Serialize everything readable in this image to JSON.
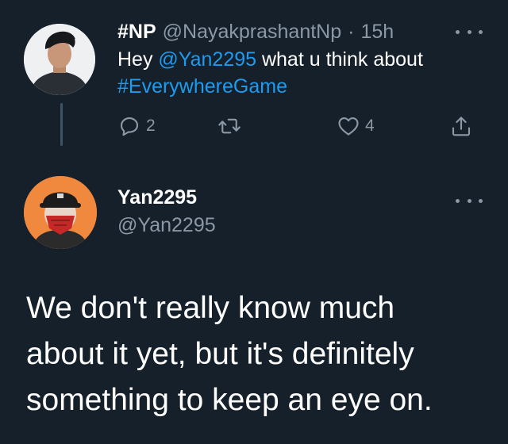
{
  "parent_tweet": {
    "display_name": "#NP",
    "handle": "@NayakprashantNp",
    "separator": "·",
    "time": "15h",
    "text_before": "Hey ",
    "mention": "@Yan2295",
    "text_after": " what u think about",
    "hashtag": "#EverywhereGame",
    "reply_count": "2",
    "like_count": "4",
    "icons": {
      "reply": "reply-icon",
      "retweet": "retweet-icon",
      "like": "heart-icon",
      "share": "share-icon",
      "more": "more-icon"
    }
  },
  "reply_tweet": {
    "display_name": "Yan2295",
    "handle": "@Yan2295",
    "text_line1": "We don't really know much",
    "text_line2": "about it yet, but it's definitely",
    "text_line3": "something to keep an eye on."
  },
  "colors": {
    "background": "#15202b",
    "accent": "#1d9bf0",
    "secondary_text": "#8b98a5",
    "primary_text": "#ffffff"
  }
}
